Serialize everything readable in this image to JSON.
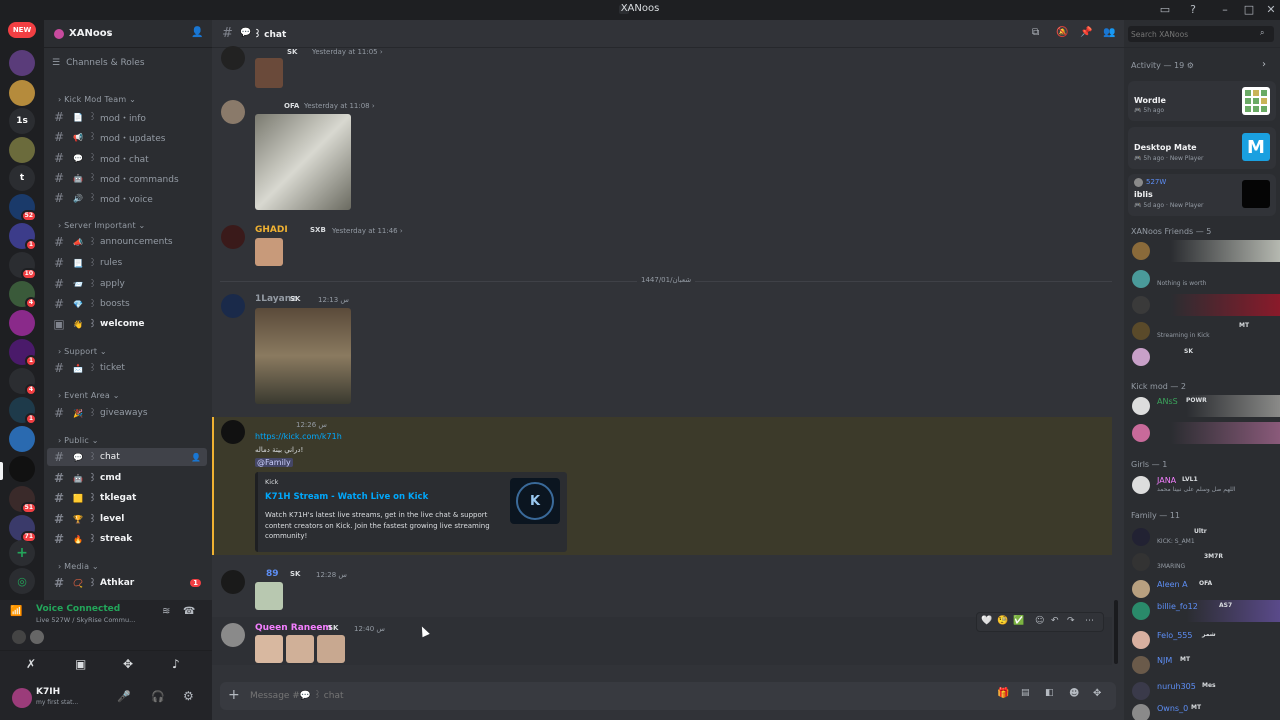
{
  "window": {
    "title": "XANoos"
  },
  "server": {
    "name": "XANoos",
    "menu_item": "Channels & Roles"
  },
  "rail": {
    "new_badge": "NEW",
    "mentions": [
      "1s",
      "t"
    ],
    "badges": [
      "52",
      "1",
      "10",
      "4",
      "1",
      "4",
      "1",
      "51",
      "71"
    ]
  },
  "categories": {
    "kick_mod": "Kick Mod Team",
    "server_important": "Server Important",
    "support": "Support",
    "event_area": "Event Area",
    "public": "Public",
    "media": "Media"
  },
  "channels": [
    {
      "label": "mod・info",
      "icon": "📄"
    },
    {
      "label": "mod・updates",
      "icon": "📢"
    },
    {
      "label": "mod・chat",
      "icon": "💬"
    },
    {
      "label": "mod・commands",
      "icon": "🤖"
    },
    {
      "label": "mod・voice",
      "icon": "🔊"
    },
    {
      "label": "announcements",
      "icon": "📣"
    },
    {
      "label": "rules",
      "icon": "📃"
    },
    {
      "label": "apply",
      "icon": "📨"
    },
    {
      "label": "boosts",
      "icon": "💎"
    },
    {
      "label": "welcome",
      "icon": "👋"
    },
    {
      "label": "ticket",
      "icon": "📩"
    },
    {
      "label": "giveaways",
      "icon": "🎉"
    },
    {
      "label": "chat",
      "icon": "💬"
    },
    {
      "label": "cmd",
      "icon": "🤖"
    },
    {
      "label": "tklegat",
      "icon": "🟨"
    },
    {
      "label": "level",
      "icon": "🏆"
    },
    {
      "label": "streak",
      "icon": "🔥"
    },
    {
      "label": "Athkar",
      "icon": "📿",
      "badge": "1"
    }
  ],
  "voice": {
    "status": "Voice Connected",
    "detail": "Live 527W / SkyRise Commu..."
  },
  "user": {
    "name": "K7IH",
    "status": "my first stat..."
  },
  "header": {
    "channel": "chat"
  },
  "messages": [
    {
      "author": "",
      "tag": "SK",
      "time": "Yesterday at 11:05 ›"
    },
    {
      "author": "",
      "tag": "OFA",
      "time": "Yesterday at 11:08 ›"
    },
    {
      "author": "GHADI",
      "tag": "SXB",
      "time": "Yesterday at 11:46 ›"
    },
    {
      "author": "1Layanz",
      "tag": "SK",
      "time": "12:13 س"
    },
    {
      "author": "",
      "tag": "",
      "time": "12:26 س",
      "link": "https://kick.com/k71h",
      "text": "دراني بيتة دماله!",
      "mention": "@Family"
    },
    {
      "author": "89",
      "tag": "SK",
      "time": "12:28 س"
    },
    {
      "author": "Queen Raneem",
      "tag": "SK",
      "time": "12:40 س"
    }
  ],
  "date_divider": "شعبان/1447/01",
  "embed": {
    "provider": "Kick",
    "title": "K71H Stream - Watch Live on Kick",
    "description": "Watch K71H's latest live streams, get in the live chat & support content creators on Kick. Join the fastest growing live streaming community!"
  },
  "composer": {
    "placeholder": "Message #💬 ꒱ chat"
  },
  "search": {
    "placeholder": "Search XANoos"
  },
  "activity": {
    "header": "Activity — 19",
    "items": [
      {
        "title": "Wordle",
        "meta": "5h ago",
        "extra": ""
      },
      {
        "title": "Desktop Mate",
        "meta": "5h ago",
        "extra": "New Player"
      },
      {
        "title": "iblis",
        "user": "527W",
        "meta": "5d ago",
        "extra": "New Player"
      }
    ]
  },
  "groups": [
    {
      "title": "XANoos Friends — 5",
      "members": [
        {
          "name": "",
          "status": "",
          "color": "#949ba4"
        },
        {
          "name": "",
          "status": "Nothing is worth",
          "color": "#949ba4"
        },
        {
          "name": "",
          "status": "",
          "color": "#949ba4"
        },
        {
          "name": "",
          "status": "Streaming in Kick",
          "tag": "MT",
          "color": "#949ba4"
        },
        {
          "name": "",
          "tag": "SK",
          "color": "#949ba4"
        }
      ]
    },
    {
      "title": "Kick mod — 2",
      "members": [
        {
          "name": "ANsS",
          "tag": "POWR",
          "color": "#3ba55c"
        },
        {
          "name": "",
          "status": "",
          "color": "#949ba4"
        }
      ]
    },
    {
      "title": "Girls — 1",
      "members": [
        {
          "name": "JANA",
          "tag": "LVL1",
          "status": "اللهم صل وسلم على نبينا محمد",
          "color": "#f47fff"
        }
      ]
    },
    {
      "title": "Family — 11",
      "members": [
        {
          "name": "",
          "tag": "Ultr",
          "status": "KICK: S_AM1",
          "color": "#dbdee1"
        },
        {
          "name": "",
          "tag": "3M7R",
          "status": "3MARING",
          "color": "#949ba4"
        },
        {
          "name": "Aleen A",
          "tag": "OFA",
          "color": "#5d8ef5"
        },
        {
          "name": "billie_fo12",
          "tag": "AS7",
          "color": "#5d8ef5"
        },
        {
          "name": "Felo_555",
          "tag": "شمر",
          "color": "#5d8ef5"
        },
        {
          "name": "NJM",
          "tag": "MT",
          "color": "#5d8ef5"
        },
        {
          "name": "nuruh305",
          "tag": "Mes",
          "color": "#5d8ef5"
        },
        {
          "name": "Owns_0",
          "tag": "MT",
          "color": "#5d8ef5"
        }
      ]
    }
  ],
  "icons": {
    "thread": "#",
    "pin": "📌",
    "members": "👥",
    "inbox": "📥",
    "help": "?"
  },
  "colors": {
    "accent": "#5865f2",
    "mention_bg": "#3c3a2a",
    "link": "#00a8fc",
    "voice": "#23a55a"
  }
}
